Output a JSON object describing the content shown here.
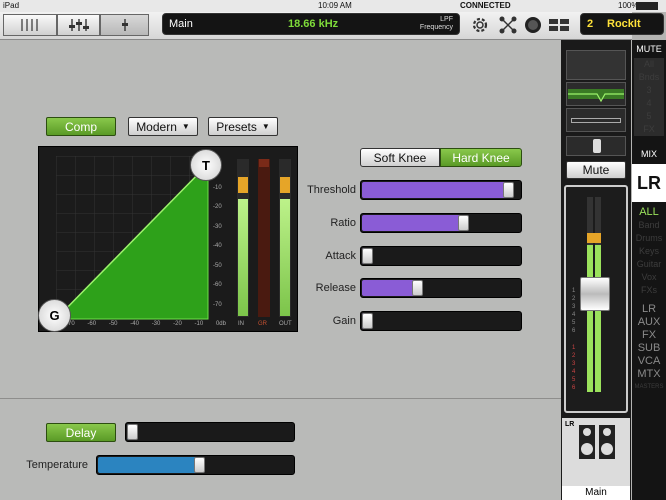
{
  "status": {
    "device": "iPad",
    "time": "10:09 AM",
    "connected": "CONNECTED",
    "battery": "100%"
  },
  "toolbar": {
    "channel_name": "Main",
    "frequency": "18.66 kHz",
    "filter_type": "LPF",
    "filter_label": "Frequency",
    "scene_number": "2",
    "scene_name": "RockIt"
  },
  "comp": {
    "button_label": "Comp",
    "mode": "Modern",
    "presets": "Presets",
    "graph_top_handle": "T",
    "graph_bottom_handle": "G",
    "x_ticks": [
      "-70",
      "-60",
      "-50",
      "-40",
      "-30",
      "-20",
      "-10",
      "0db"
    ],
    "y_ticks": [
      "0",
      "-10",
      "-20",
      "-30",
      "-40",
      "-50",
      "-60",
      "-70"
    ],
    "meter_labels": [
      "IN",
      "GR",
      "OUT"
    ]
  },
  "knee": {
    "soft": "Soft Knee",
    "hard": "Hard Knee"
  },
  "params": [
    {
      "label": "Threshold",
      "value": 0.96
    },
    {
      "label": "Ratio",
      "value": 0.65
    },
    {
      "label": "Attack",
      "value": 0.0
    },
    {
      "label": "Release",
      "value": 0.34
    },
    {
      "label": "Gain",
      "value": 0.0
    }
  ],
  "delay": {
    "button_label": "Delay",
    "value": 0.0
  },
  "temperature": {
    "label": "Temperature",
    "value": 0.52
  },
  "strip": {
    "mute_label": "Mute",
    "main_label": "Main",
    "lr_tag": "LR",
    "meter_scale_left": [
      "1",
      "2",
      "3",
      "4",
      "5",
      "6"
    ],
    "meter_scale_right": [
      "1",
      "2",
      "3",
      "4",
      "5",
      "6"
    ]
  },
  "mute_col": {
    "title": "MUTE",
    "items": [
      "All",
      "Bnds",
      "3",
      "4",
      "5",
      "FX"
    ]
  },
  "mix_col": {
    "title": "MIX",
    "selected": "LR",
    "all": "ALL",
    "items": [
      "Band",
      "Drums",
      "Keys",
      "Guitar",
      "Vox",
      "FXs"
    ],
    "groups": [
      "LR",
      "AUX",
      "FX",
      "SUB",
      "VCA",
      "MTX"
    ],
    "footer": "MASTERS"
  },
  "colors": {
    "accent_green": "#6aab33",
    "purple": "#8a5cd6",
    "blue": "#2b84c0",
    "yellow": "#ffe23a"
  }
}
